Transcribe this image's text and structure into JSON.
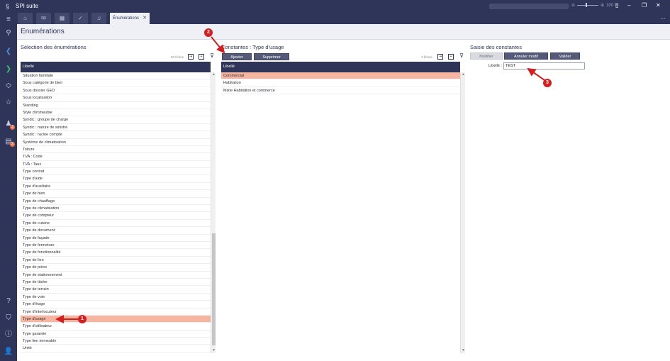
{
  "app": {
    "title": "SPI suite",
    "zoom": "100 %"
  },
  "tabs": {
    "active_label": "Énumérations"
  },
  "page": {
    "title": "Enumérations"
  },
  "left_panel": {
    "title": "Sélection des énumérations",
    "count": "90 fiches",
    "column": "Libellé",
    "items": [
      "Situation familiale",
      "Sous catégorie de bien",
      "Sous dossier GED",
      "Sous localisation",
      "Standing",
      "Style d'immeuble",
      "Syndic : groupe de charge",
      "Syndic : nature de sinistre",
      "Syndic : racine compte",
      "Système de climatisation",
      "Toiture",
      "TVA : Code",
      "TVA : Taux",
      "Type contrat",
      "Type d'aide",
      "Type d'auxiliaire",
      "Type de bien",
      "Type de chauffage",
      "Type de climatisation",
      "Type de compteur",
      "Type de cuisine",
      "Type de document",
      "Type de façade",
      "Type de fermeture",
      "Type de fonctionnalité",
      "Type de lien",
      "Type de pièce",
      "Type de stationnement",
      "Type de tâche",
      "Type de terrain",
      "Type de voie",
      "Type d'étage",
      "Type d'interlocuteur",
      "Type d'usage",
      "Type d'utilisateur",
      "Type garantie",
      "Type lien immeuble",
      "Unité"
    ],
    "selected_index": 33
  },
  "middle_panel": {
    "title": "Constantes : Type d'usage",
    "count": "3 fiches",
    "add_label": "Ajouter",
    "delete_label": "Supprimer",
    "column": "Libellé",
    "items": [
      "Commercial",
      "Habitation",
      "Mixte Habitation et commerce"
    ],
    "selected_index": 0
  },
  "right_panel": {
    "title": "Saisie des constantes",
    "modify_label": "Modifier",
    "cancel_label": "Annuler modif",
    "validate_label": "Valider",
    "field_label": "Libellé :",
    "field_value": "TEST"
  },
  "callouts": {
    "one": "1",
    "two": "2",
    "three": "3"
  },
  "colors": {
    "navy": "#2e3558",
    "selection": "#f5b5a0",
    "callout": "#d21f1f"
  }
}
